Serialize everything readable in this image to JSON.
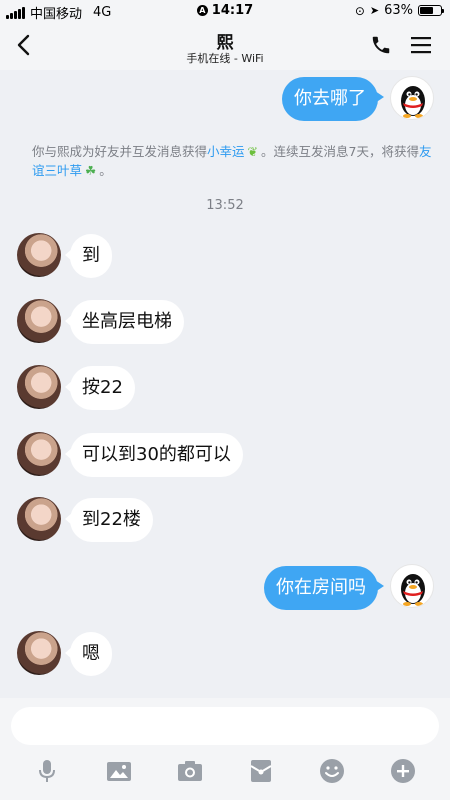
{
  "status_bar": {
    "carrier": "中国移动",
    "network": "4G",
    "time": "14:17",
    "battery_percent": "63%",
    "battery_level": 0.63
  },
  "nav": {
    "title": "熙",
    "subtitle": "手机在线 - WiFi"
  },
  "messages": {
    "m1": "你去哪了",
    "notice": {
      "text_before": "你与熙成为好友并互发消息获得",
      "link1": "小幸运",
      "text_middle": "。连续互发消息7天，将获得",
      "link2": "友谊三叶草",
      "text_end": "。"
    },
    "time": "13:52",
    "m2": "到",
    "m3": "坐高层电梯",
    "m4": "按22",
    "m5": "可以到30的都可以",
    "m6": "到22楼",
    "m7": "你在房间吗",
    "m8": "嗯"
  },
  "input": {
    "value": "",
    "placeholder": ""
  },
  "colors": {
    "outgoing_bubble": "#3fa6f3",
    "link": "#2e9bf0",
    "background": "#eef0f4"
  }
}
